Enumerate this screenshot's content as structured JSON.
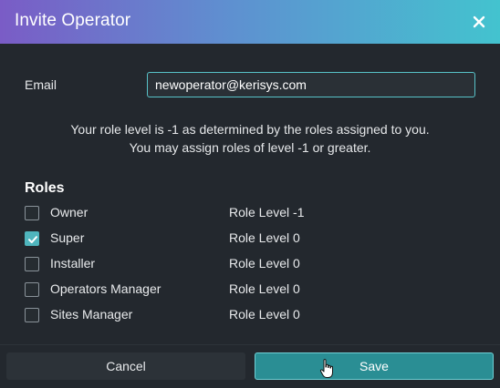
{
  "dialog": {
    "title": "Invite Operator",
    "close_icon": "close-icon"
  },
  "form": {
    "email_label": "Email",
    "email_value": "newoperator@kerisys.com"
  },
  "info": {
    "line1": "Your role level is -1 as determined by the roles assigned to you.",
    "line2": "You may assign roles of level -1 or greater."
  },
  "roles": {
    "title": "Roles",
    "items": [
      {
        "name": "Owner",
        "level": "Role Level -1",
        "checked": false
      },
      {
        "name": "Super",
        "level": "Role Level 0",
        "checked": true
      },
      {
        "name": "Installer",
        "level": "Role Level 0",
        "checked": false
      },
      {
        "name": "Operators Manager",
        "level": "Role Level 0",
        "checked": false
      },
      {
        "name": "Sites Manager",
        "level": "Role Level 0",
        "checked": false
      }
    ]
  },
  "footer": {
    "cancel_label": "Cancel",
    "save_label": "Save"
  },
  "colors": {
    "accent": "#4fb5bd",
    "header_gradient_start": "#7a5cc6",
    "header_gradient_end": "#43c3cf"
  }
}
